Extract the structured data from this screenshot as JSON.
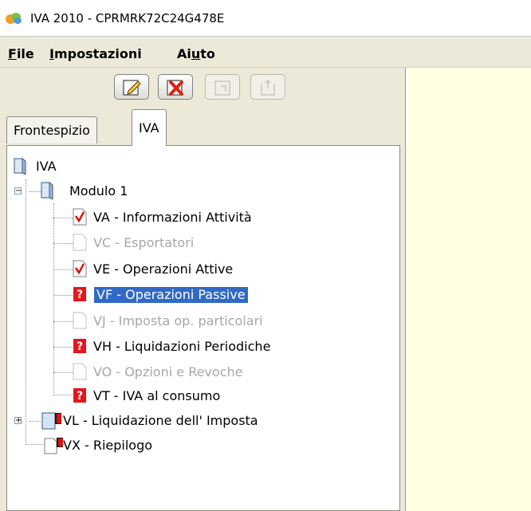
{
  "window": {
    "title": "IVA 2010 - CPRMRK72C24G478E"
  },
  "menu": [
    {
      "label": "File",
      "mnemonic": "F",
      "rest": "ile"
    },
    {
      "label": "Impostazioni",
      "mnemonic": "I",
      "rest": "mpostazioni"
    },
    {
      "label": "Aiuto",
      "pre": "Ai",
      "mnemonic": "u",
      "post": "to"
    }
  ],
  "toolbar": {
    "buttons": [
      {
        "icon": "edit-icon",
        "enabled": true
      },
      {
        "icon": "delete-icon",
        "enabled": true
      },
      {
        "icon": "page-icon",
        "enabled": false
      },
      {
        "icon": "page-up-icon",
        "enabled": false
      }
    ]
  },
  "tabs": [
    {
      "label": "Frontespizio",
      "active": false
    },
    {
      "label": "IVA",
      "active": true
    }
  ],
  "tree": {
    "root": "IVA",
    "module": "Modulo 1",
    "items": [
      {
        "label": "VA - Informazioni Attività",
        "status": "checked",
        "disabled": false,
        "selected": false
      },
      {
        "label": "VC - Esportatori",
        "status": "blank",
        "disabled": true,
        "selected": false
      },
      {
        "label": "VE - Operazioni Attive",
        "status": "checked",
        "disabled": false,
        "selected": false
      },
      {
        "label": "VF - Operazioni Passive",
        "status": "question",
        "disabled": false,
        "selected": true
      },
      {
        "label": "VJ - Imposta op. particolari",
        "status": "blank",
        "disabled": true,
        "selected": false
      },
      {
        "label": "VH - Liquidazioni Periodiche",
        "status": "question",
        "disabled": false,
        "selected": false
      },
      {
        "label": "VO - Opzioni e Revoche",
        "status": "blank",
        "disabled": true,
        "selected": false
      },
      {
        "label": "VT - IVA al consumo",
        "status": "question",
        "disabled": false,
        "selected": false
      }
    ],
    "sections": [
      {
        "label": "VL - Liquidazione dell' Imposta",
        "expandable": true
      },
      {
        "label": "VX - Riepilogo",
        "expandable": false
      }
    ]
  },
  "colors": {
    "selection": "#316ac5",
    "right_panel": "#ffffe1",
    "question_red": "#e8141b",
    "check_red": "#e01010"
  }
}
